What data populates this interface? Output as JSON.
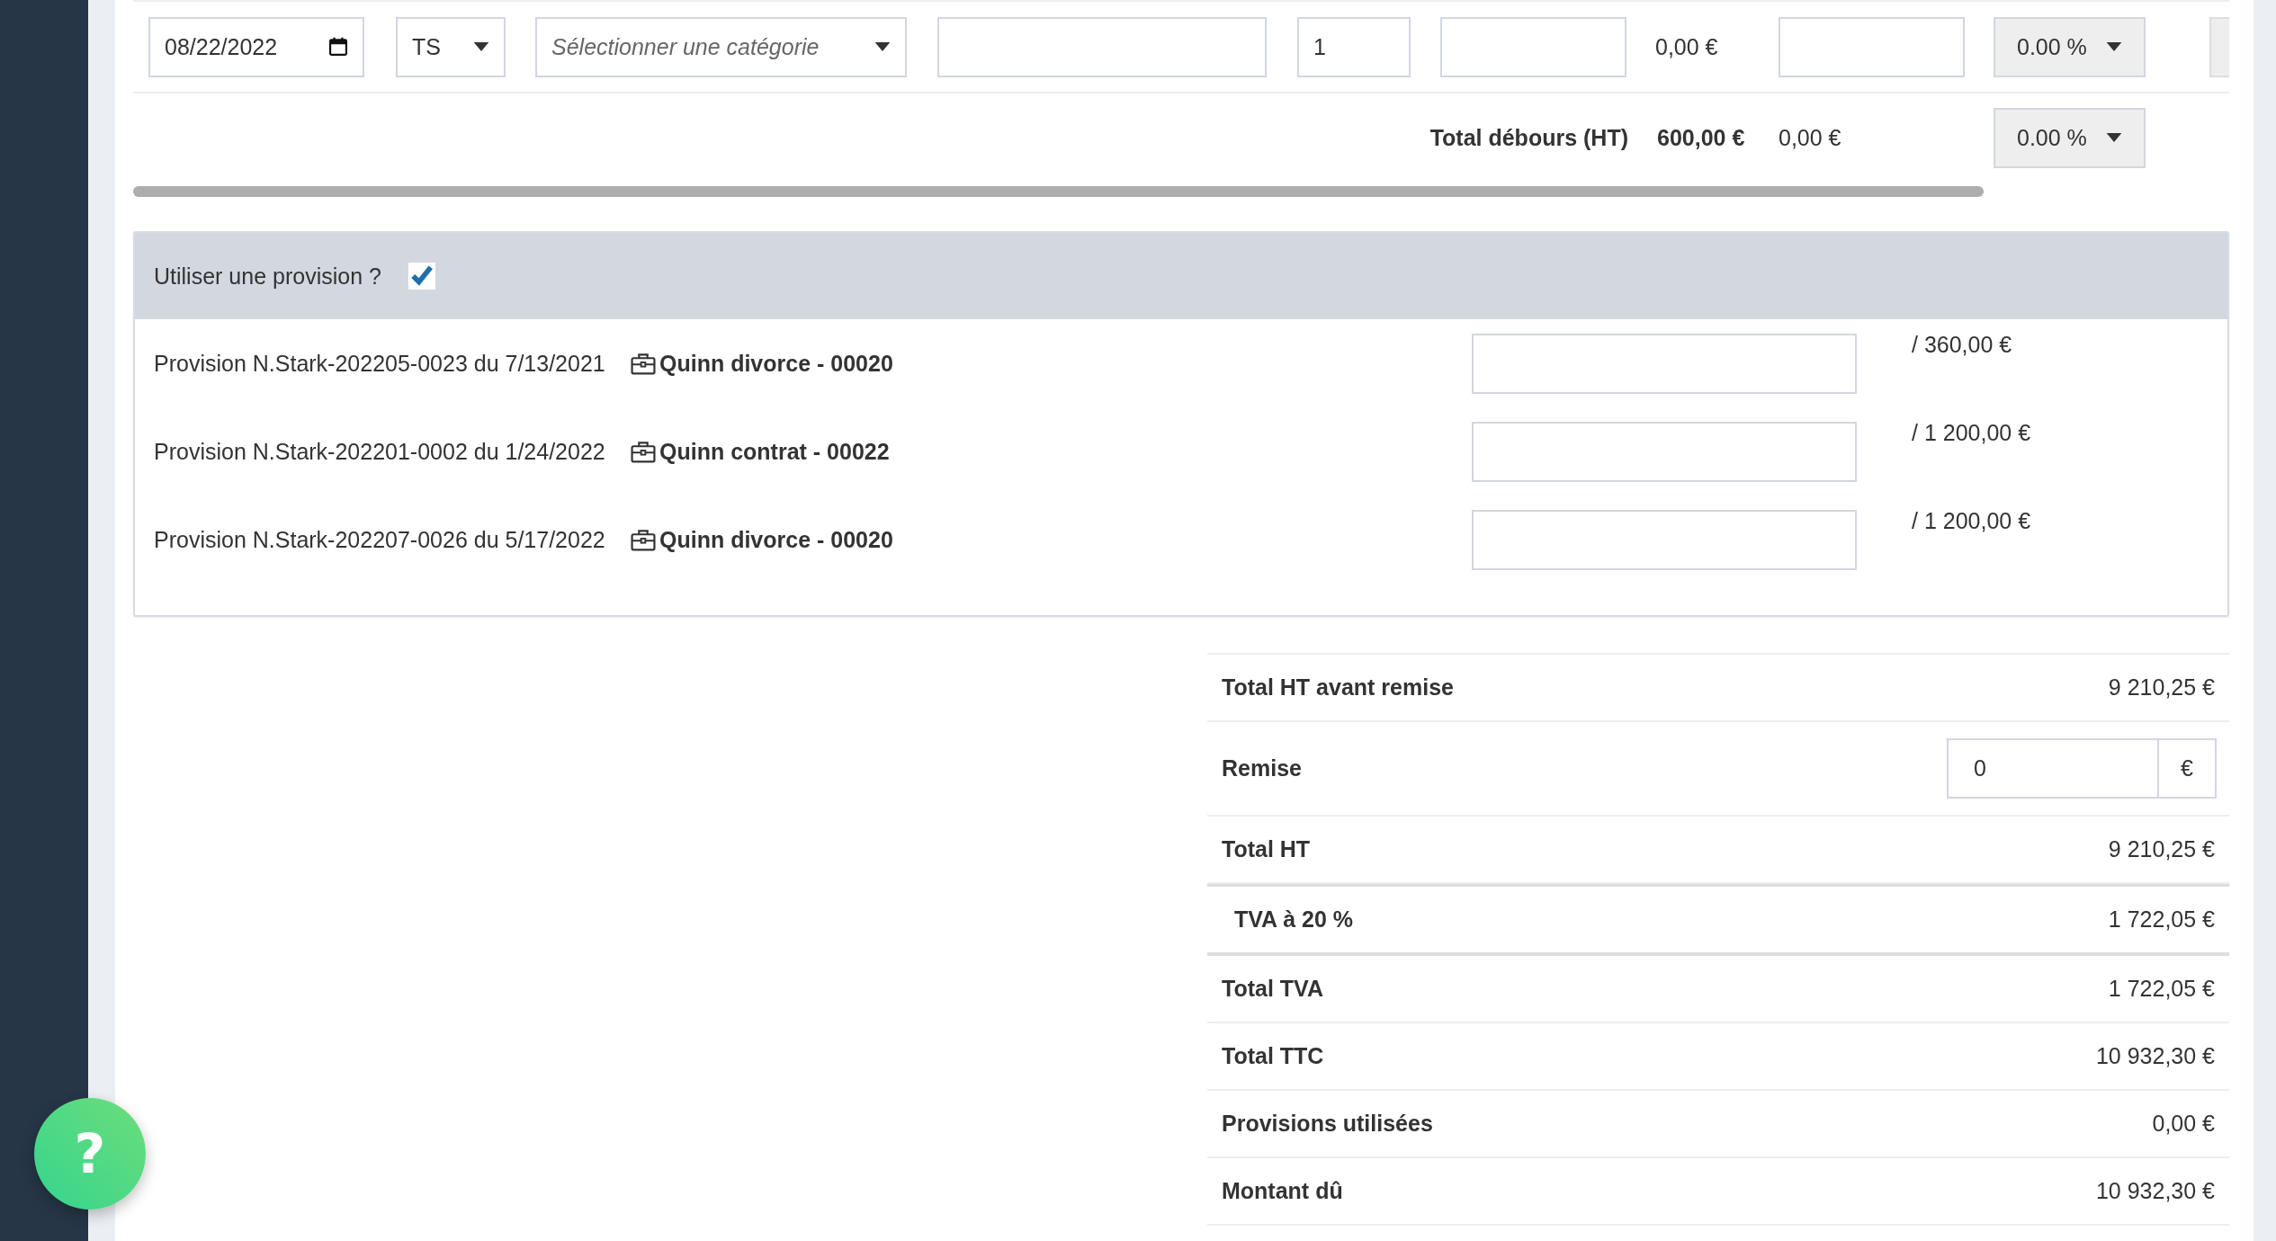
{
  "line_row": {
    "date": "08/22/2022",
    "type": "TS",
    "category": {
      "placeholder": "Sélectionner une catégorie"
    },
    "quantity": "1",
    "amount": "0,00 €",
    "vat": "0.00 %"
  },
  "debours_total": {
    "label": "Total débours (HT)",
    "amount": "600,00 €",
    "amount_2": "0,00 €",
    "vat": "0.00 %"
  },
  "provision": {
    "label": "Utiliser une provision ?",
    "checked": true,
    "items": [
      {
        "text": "Provision N.Stark-202205-0023 du 7/13/2021",
        "case": "Quinn divorce - 00020",
        "max": "/ 360,00 €"
      },
      {
        "text": "Provision N.Stark-202201-0002 du 1/24/2022",
        "case": "Quinn contrat - 00022",
        "max": "/ 1 200,00 €"
      },
      {
        "text": "Provision N.Stark-202207-0026 du 5/17/2022",
        "case": "Quinn divorce - 00020",
        "max": "/ 1 200,00 €"
      }
    ]
  },
  "totals": [
    {
      "kind": "total",
      "label": "Total HT avant remise",
      "value": "9 210,25 €"
    },
    {
      "kind": "input",
      "label": "Remise",
      "value": "0",
      "unit": "€"
    },
    {
      "kind": "total",
      "label": "Total HT",
      "value": "9 210,25 €"
    },
    {
      "kind": "tax",
      "label": "TVA à 20 %",
      "value": "1 722,05 €"
    },
    {
      "kind": "total",
      "label": "Total TVA",
      "value": "1 722,05 €"
    },
    {
      "kind": "total",
      "label": "Total TTC",
      "value": "10 932,30 €"
    },
    {
      "kind": "total",
      "label": "Provisions utilisées",
      "value": "0,00 €"
    },
    {
      "kind": "total",
      "label": "Montant dû",
      "value": "10 932,30 €"
    }
  ],
  "help_button": {
    "label": "?"
  }
}
